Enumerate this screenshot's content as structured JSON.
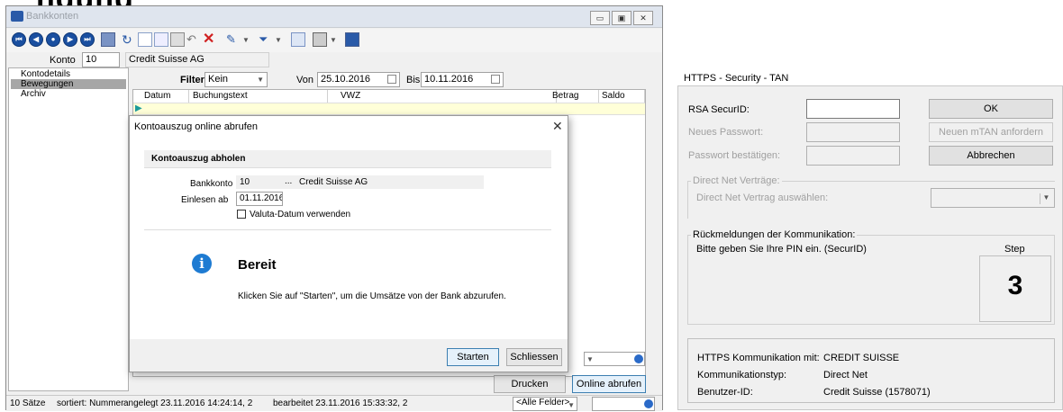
{
  "page_title": "ngung",
  "main_window": {
    "title": "Bankkonten",
    "konto_label": "Konto",
    "konto_value": "10",
    "konto_name": "Credit Suisse AG",
    "filter_label": "Filter",
    "filter_value": "Kein",
    "von_label": "Von",
    "von_value": "25.10.2016",
    "bis_label": "Bis",
    "bis_value": "10.11.2016",
    "nav": [
      "Kontodetails",
      "Bewegungen",
      "Archiv"
    ],
    "columns": [
      "Datum",
      "Buchungstext",
      "VWZ",
      "Betrag",
      "Saldo"
    ],
    "buttons": {
      "drucken": "Drucken",
      "online": "Online abrufen"
    },
    "status": {
      "count": "10 Sätze",
      "sort": "sortiert: Nummer",
      "created": "angelegt 23.11.2016 14:24:14, 2",
      "edited": "bearbeitet 23.11.2016 15:33:32, 2",
      "fields": "<Alle Felder>"
    }
  },
  "dialog": {
    "title": "Kontoauszug online abrufen",
    "section": "Kontoauszug abholen",
    "bankkonto_label": "Bankkonto",
    "bankkonto_value": "10",
    "bankkonto_ellipsis": "...",
    "bankkonto_name": "Credit Suisse AG",
    "einlesen_label": "Einlesen ab",
    "einlesen_value": "01.11.2016",
    "valuta_label": "Valuta-Datum verwenden",
    "status_title": "Bereit",
    "status_text": "Klicken Sie auf \"Starten\", um die Umsätze von der Bank abzurufen.",
    "btn_start": "Starten",
    "btn_close": "Schliessen"
  },
  "tan_panel": {
    "title": "HTTPS - Security - TAN",
    "rsa_label": "RSA SecurID:",
    "neues_label": "Neues Passwort:",
    "bestaetigen_label": "Passwort bestätigen:",
    "btn_ok": "OK",
    "btn_mtan": "Neuen mTAN anfordern",
    "btn_abbrechen": "Abbrechen",
    "group_vertraege": "Direct Net Verträge:",
    "vertrag_label": "Direct Net Vertrag auswählen:",
    "group_rueck": "Rückmeldungen der Kommunikation:",
    "rueck_text": "Bitte geben Sie Ihre PIN ein. (SecurID)",
    "step_label": "Step",
    "step_value": "3",
    "komm_label": "HTTPS Kommunikation mit:",
    "komm_value": "CREDIT SUISSE",
    "typ_label": "Kommunikationstyp:",
    "typ_value": "Direct Net",
    "benutzer_label": "Benutzer-ID:",
    "benutzer_value": "Credit Suisse (1578071)"
  }
}
